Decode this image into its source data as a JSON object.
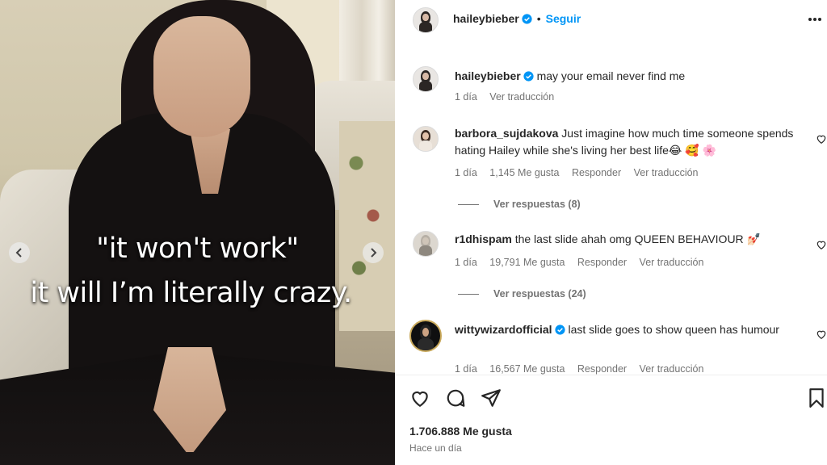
{
  "media": {
    "caption_line1": "\"it won't work\"",
    "caption_line2": "it will I’m literally crazy."
  },
  "header": {
    "username": "haileybieber",
    "separator": "•",
    "follow_label": "Seguir"
  },
  "caption_comment": {
    "username": "haileybieber",
    "text": "may your email never find me",
    "time": "1 día",
    "translate": "Ver traducción"
  },
  "comments": [
    {
      "username": "barbora_sujdakova",
      "text": "Just imagine how much time someone spends hating Hailey while she's living her best life😂 🥰 🌸",
      "time": "1 día",
      "likes": "1,145 Me gusta",
      "reply": "Responder",
      "translate": "Ver traducción",
      "view_replies": "Ver respuestas (8)"
    },
    {
      "username": "r1dhispam",
      "text": "the last slide ahah omg QUEEN BEHAVIOUR 💅🏻",
      "time": "1 día",
      "likes": "19,791 Me gusta",
      "reply": "Responder",
      "translate": "Ver traducción",
      "view_replies": "Ver respuestas (24)"
    },
    {
      "username": "wittywizardofficial",
      "text": "last slide goes to show queen has humour",
      "time": "1 día",
      "likes": "16,567 Me gusta",
      "reply": "Responder",
      "translate": "Ver traducción"
    }
  ],
  "footer": {
    "likes": "1.706.888 Me gusta",
    "time": "Hace un día"
  },
  "icons": {
    "verified": "verified-badge-icon",
    "more": "more-options-icon",
    "like": "heart-icon",
    "comment": "comment-icon",
    "share": "send-icon",
    "save": "bookmark-icon",
    "prev": "chevron-left-icon",
    "next": "chevron-right-icon"
  },
  "colors": {
    "accent": "#0095f6",
    "text": "#262626",
    "muted": "#737373"
  }
}
